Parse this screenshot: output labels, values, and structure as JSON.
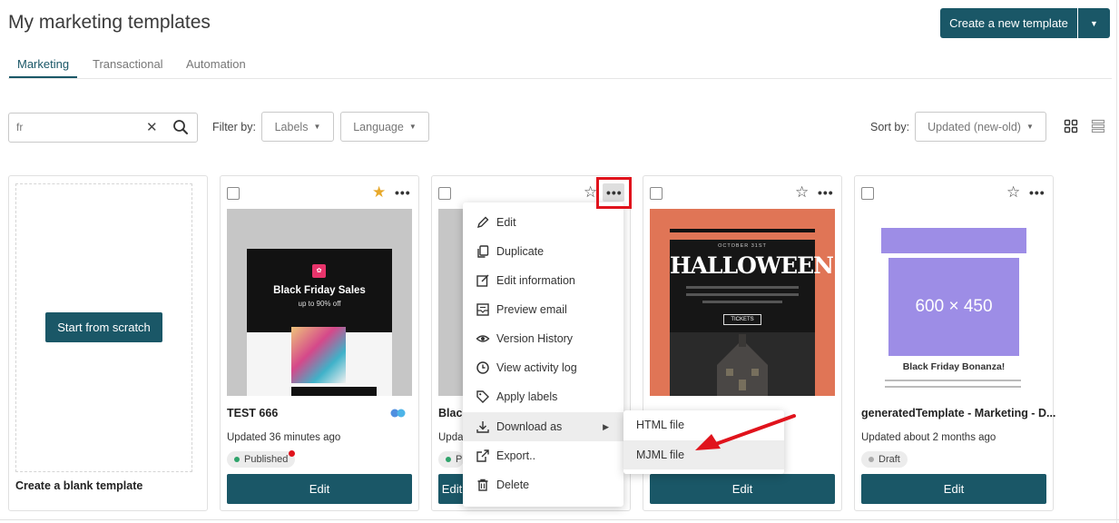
{
  "header": {
    "title": "My marketing templates",
    "create_label": "Create a new template"
  },
  "tabs": [
    {
      "label": "Marketing",
      "active": true
    },
    {
      "label": "Transactional",
      "active": false
    },
    {
      "label": "Automation",
      "active": false
    }
  ],
  "toolbar": {
    "search_value": "fr",
    "filter_label": "Filter by:",
    "labels_dropdown": "Labels",
    "language_dropdown": "Language",
    "sort_label": "Sort by:",
    "sort_value": "Updated (new-old)"
  },
  "scratch_card": {
    "button_label": "Start from scratch",
    "caption": "Create a blank template"
  },
  "cards": [
    {
      "name": "TEST 666",
      "updated": "Updated 36 minutes ago",
      "status": "Published",
      "starred": true,
      "edit_label": "Edit",
      "thumb_title": "Black Friday Sales",
      "thumb_subtitle": "up to 90% off"
    },
    {
      "name": "Black",
      "updated": "Upda",
      "status": "P",
      "starred": false,
      "edit_label": "Edit"
    },
    {
      "name": "",
      "updated": "",
      "starred": false,
      "edit_label": "Edit",
      "thumb_kicker": "OCTOBER 31ST",
      "thumb_title": "HALLOWEEN",
      "thumb_button": "TICKETS"
    },
    {
      "name": "generatedTemplate - Marketing - D...",
      "updated": "Updated about 2 months ago",
      "status": "Draft",
      "starred": false,
      "edit_label": "Edit",
      "thumb_placeholder": "600 × 450",
      "thumb_title": "Black Friday Bonanza!"
    }
  ],
  "context_menu": {
    "items": [
      {
        "label": "Edit",
        "icon": "pencil-icon"
      },
      {
        "label": "Duplicate",
        "icon": "copy-icon"
      },
      {
        "label": "Edit information",
        "icon": "edit-info-icon"
      },
      {
        "label": "Preview email",
        "icon": "preview-icon"
      },
      {
        "label": "Version History",
        "icon": "eye-icon"
      },
      {
        "label": "View activity log",
        "icon": "clock-icon"
      },
      {
        "label": "Apply labels",
        "icon": "tag-icon"
      },
      {
        "label": "Download as",
        "icon": "download-icon"
      },
      {
        "label": "Export..",
        "icon": "export-icon"
      },
      {
        "label": "Delete",
        "icon": "trash-icon"
      }
    ],
    "submenu": [
      {
        "label": "HTML file"
      },
      {
        "label": "MJML file"
      }
    ]
  },
  "colors": {
    "primary": "#1a5767",
    "star_active": "#e8a92b",
    "published_dot": "#2fa36b",
    "notification_dot": "#e0131c",
    "highlight_red": "#e0131c",
    "halloween_bg": "#e07556"
  }
}
